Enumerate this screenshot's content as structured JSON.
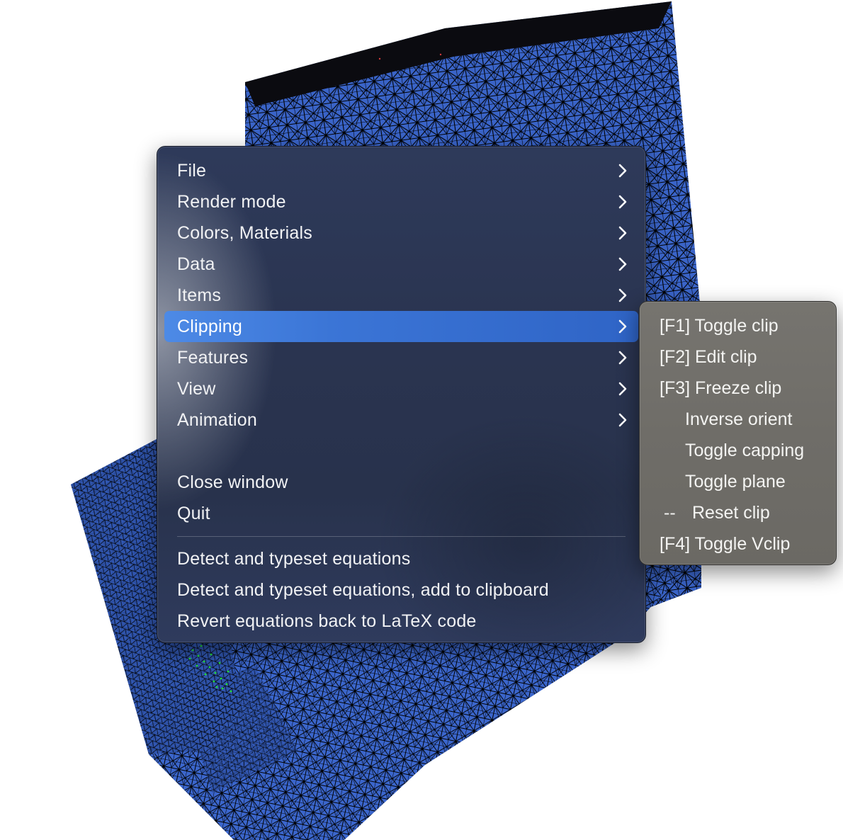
{
  "main_menu": {
    "items": [
      {
        "label": "File",
        "has_submenu": true
      },
      {
        "label": "Render mode",
        "has_submenu": true
      },
      {
        "label": "Colors, Materials",
        "has_submenu": true
      },
      {
        "label": "Data",
        "has_submenu": true
      },
      {
        "label": "Items",
        "has_submenu": true
      },
      {
        "label": "Clipping",
        "has_submenu": true,
        "selected": true
      },
      {
        "label": "Features",
        "has_submenu": true
      },
      {
        "label": "View",
        "has_submenu": true
      },
      {
        "label": "Animation",
        "has_submenu": true
      }
    ],
    "window_items": [
      {
        "label": "Close window"
      },
      {
        "label": "Quit"
      }
    ],
    "service_items": [
      {
        "label": "Detect and typeset equations"
      },
      {
        "label": "Detect and typeset equations, add to clipboard"
      },
      {
        "label": "Revert equations back to LaTeX code"
      }
    ]
  },
  "clipping_submenu": {
    "items": [
      {
        "label": "[F1] Toggle clip"
      },
      {
        "label": "[F2] Edit clip"
      },
      {
        "label": "[F3] Freeze clip"
      },
      {
        "label": "Inverse orient"
      },
      {
        "label": "Toggle capping"
      },
      {
        "label": "Toggle plane"
      },
      {
        "prefix": "--",
        "label": "Reset clip"
      },
      {
        "label": "[F4] Toggle Vclip"
      }
    ]
  },
  "viewport": {
    "mesh_color": "#3a64c8",
    "edge_color": "#000000",
    "highlight_color": "#22dd33"
  },
  "icons": {
    "submenu_indicator": "chevron-right-icon"
  }
}
